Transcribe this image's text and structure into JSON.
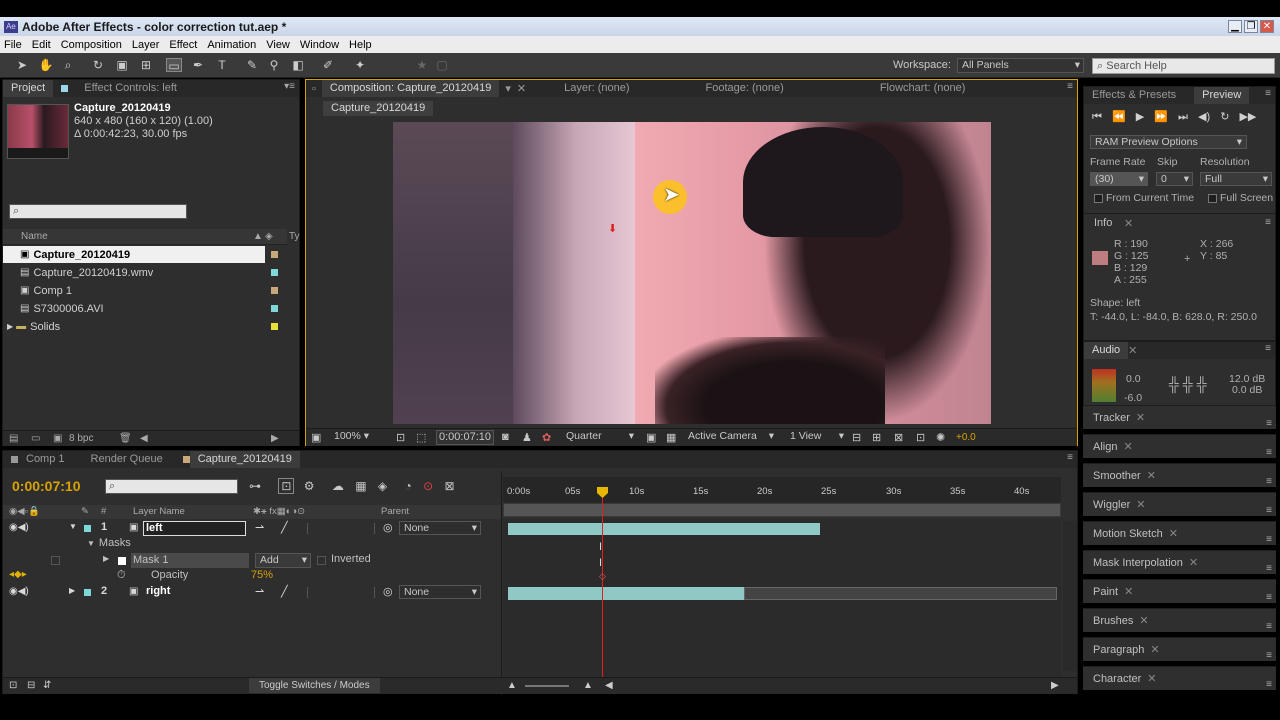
{
  "window": {
    "title": "Adobe After Effects - color correction tut.aep *",
    "app_icon": "Ae"
  },
  "menu": [
    "File",
    "Edit",
    "Composition",
    "Layer",
    "Effect",
    "Animation",
    "View",
    "Window",
    "Help"
  ],
  "toolbar": {
    "workspace_label": "Workspace:",
    "workspace_value": "All Panels",
    "search_placeholder": "Search Help"
  },
  "project": {
    "tabs": [
      "Project",
      "Effect Controls: left"
    ],
    "item_name": "Capture_20120419",
    "item_dims": "640 x 480  (160 x 120) (1.00)",
    "item_duration": "Δ 0:00:42:23, 30.00 fps",
    "col_name": "Name",
    "items": [
      {
        "name": "Capture_20120419",
        "color": "#c8a878"
      },
      {
        "name": "Capture_20120419.wmv",
        "color": "#7fd8d8"
      },
      {
        "name": "Comp 1",
        "color": "#c8a878"
      },
      {
        "name": "S7300006.AVI",
        "color": "#7fd8d8"
      },
      {
        "name": "Solids",
        "color": "#e6e03a"
      }
    ],
    "bpc": "8 bpc"
  },
  "comp": {
    "tab_label": "Composition: Capture_20120419",
    "tab_layer": "Layer: (none)",
    "tab_footage": "Footage: (none)",
    "tab_flowchart": "Flowchart: (none)",
    "breadcrumb": "Capture_20120419",
    "zoom": "100%",
    "timecode": "0:00:07:10",
    "resolution": "Quarter",
    "camera": "Active Camera",
    "views": "1 View",
    "exposure": "+0.0"
  },
  "right": {
    "tabs": [
      "Effects & Presets",
      "Preview"
    ],
    "ram_preview": "RAM Preview Options",
    "frame_rate_label": "Frame Rate",
    "skip_label": "Skip",
    "resolution_label": "Resolution",
    "frame_rate": "(30)",
    "skip": "0",
    "resolution": "Full",
    "from_current": "From Current Time",
    "full_screen": "Full Screen",
    "info_title": "Info",
    "info_rgb": [
      "R : 190",
      "G : 125",
      "B : 129",
      "A : 255"
    ],
    "info_xy": [
      "X : 266",
      "Y : 85"
    ],
    "info_color": "#be7d81",
    "shape_label": "Shape: left",
    "shape_bounds": "T: -44.0, L: -84.0, B: 628.0, R: 250.0",
    "audio_title": "Audio",
    "audio_levels": [
      "0.0",
      "-6.0"
    ],
    "audio_db": [
      "12.0 dB",
      "0.0 dB"
    ],
    "panels": [
      "Tracker",
      "Align",
      "Smoother",
      "Wiggler",
      "Motion Sketch",
      "Mask Interpolation",
      "Paint",
      "Brushes",
      "Paragraph",
      "Character"
    ]
  },
  "timeline": {
    "tabs": [
      "Comp 1",
      "Render Queue",
      "Capture_20120419"
    ],
    "timecode": "0:00:07:10",
    "col_layer": "Layer Name",
    "col_num": "#",
    "col_parent": "Parent",
    "layers": [
      {
        "num": "1",
        "name": "left",
        "parent": "None"
      },
      {
        "num": "2",
        "name": "right",
        "parent": "None"
      }
    ],
    "masks_label": "Masks",
    "mask_name": "Mask 1",
    "mask_mode": "Add",
    "inverted": "Inverted",
    "opacity_label": "Opacity",
    "opacity_value": "75%",
    "ruler": [
      "0:00s",
      "05s",
      "10s",
      "15s",
      "20s",
      "25s",
      "30s",
      "35s",
      "40s"
    ],
    "toggle": "Toggle Switches / Modes"
  }
}
